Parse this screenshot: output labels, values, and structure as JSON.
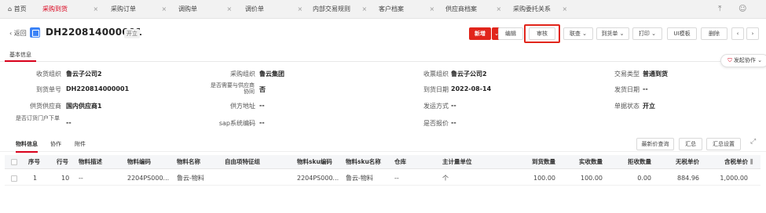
{
  "tabs": [
    {
      "label": "首页",
      "active": false,
      "closable": false
    },
    {
      "label": "采购到货",
      "active": true,
      "closable": true
    },
    {
      "label": "采购订单",
      "active": false,
      "closable": true
    },
    {
      "label": "调购单",
      "active": false,
      "closable": true
    },
    {
      "label": "调价单",
      "active": false,
      "closable": true
    },
    {
      "label": "内部交易规则",
      "active": false,
      "closable": true
    },
    {
      "label": "客户档案",
      "active": false,
      "closable": true
    },
    {
      "label": "供应商档案",
      "active": false,
      "closable": true
    },
    {
      "label": "采购委托关系",
      "active": false,
      "closable": true
    }
  ],
  "header": {
    "back": "返回",
    "doc_no": "DH220814000001",
    "status": "开立"
  },
  "actions": {
    "new": "新增",
    "edit": "编辑",
    "audit": "审核",
    "linked": "联查",
    "to_receipt": "到货单",
    "print": "打印",
    "ui_template": "UI模板",
    "delete": "删除"
  },
  "info_tab": "基本信息",
  "flow_btn": "发起协作",
  "fields": {
    "recv_org": {
      "label": "收货组织",
      "value": "鲁云子公司2"
    },
    "purchase_org": {
      "label": "采购组织",
      "value": "鲁云集团"
    },
    "invoice_org": {
      "label": "收票组织",
      "value": "鲁云子公司2"
    },
    "trade_type": {
      "label": "交易类型",
      "value": "普通到货"
    },
    "arrival_no": {
      "label": "到货单号",
      "value": "DH220814000001"
    },
    "supplier_collab": {
      "label": "是否需要与供应商协同",
      "value": "否"
    },
    "arrival_date": {
      "label": "到货日期",
      "value": "2022-08-14"
    },
    "ship_date": {
      "label": "发货日期",
      "value": "--"
    },
    "supplier": {
      "label": "供货供应商",
      "value": "国内供应商1"
    },
    "supplier_addr": {
      "label": "供方地址",
      "value": "--"
    },
    "ship_method": {
      "label": "发运方式",
      "value": "--"
    },
    "doc_status": {
      "label": "单据状态",
      "value": "开立"
    },
    "door_order": {
      "label": "是否订货门户下单",
      "value": "--"
    },
    "sap_code": {
      "label": "sap系统编码",
      "value": "--"
    },
    "quoted": {
      "label": "是否报价",
      "value": "--"
    }
  },
  "subtabs": [
    "物料信息",
    "协作",
    "附件"
  ],
  "table_tools": {
    "latest_price": "最新价查询",
    "summary": "汇总",
    "summary_settings": "汇总设置"
  },
  "table": {
    "columns": [
      "序号",
      "行号",
      "物料描述",
      "物料编码",
      "物料名称",
      "自由项特征组",
      "物料sku编码",
      "物料sku名称",
      "仓库",
      "主计量单位",
      "到货数量",
      "实收数量",
      "拒收数量",
      "无税单价",
      "含税单价"
    ],
    "rows": [
      [
        "1",
        "10",
        "--",
        "2204PS000...",
        "鲁云-物料",
        "",
        "2204PS000...",
        "鲁云-物料",
        "--",
        "个",
        "100.00",
        "100.00",
        "0.00",
        "884.96",
        "1,000.00"
      ]
    ]
  },
  "colors": {
    "accent": "#e1251b",
    "tab_active": "#d9001b",
    "doc_icon": "#3b82f6"
  },
  "icons": [
    "home-icon",
    "back-icon",
    "document-icon",
    "chevron-down-icon",
    "chevron-left-icon",
    "chevron-right-icon",
    "flow-icon",
    "expand-icon",
    "column-settings-icon",
    "collapse-up-icon",
    "user-icon"
  ]
}
